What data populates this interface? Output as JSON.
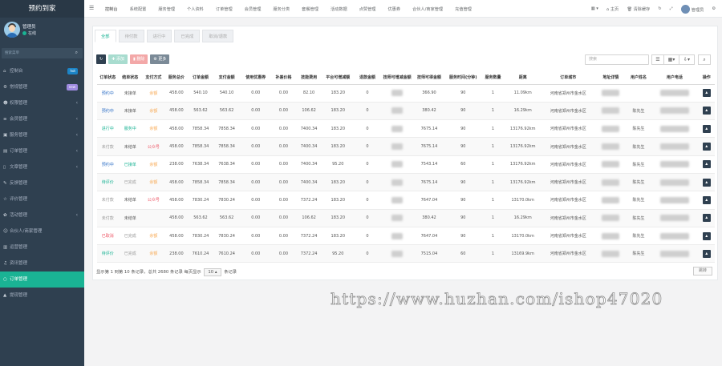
{
  "brand": "预约到家",
  "user": {
    "name": "管理员",
    "status": "在线"
  },
  "sidebar": {
    "search_placeholder": "搜索菜单",
    "items": [
      {
        "label": "控制台",
        "icon": "home-icon",
        "badge": "hot",
        "badge_color": "#1c84c6"
      },
      {
        "label": "常规管理",
        "icon": "cog-icon",
        "badge": "new",
        "badge_color": "#9e8be0"
      },
      {
        "label": "权限管理",
        "icon": "group-icon",
        "arrow": "‹"
      },
      {
        "label": "会员管理",
        "icon": "list-icon",
        "arrow": "‹"
      },
      {
        "label": "服务管理",
        "icon": "box-icon",
        "arrow": "‹"
      },
      {
        "label": "订单管理",
        "icon": "table-icon",
        "arrow": "‹"
      },
      {
        "label": "文章管理",
        "icon": "file-icon",
        "arrow": "‹"
      },
      {
        "label": "反馈管理",
        "icon": "comment-icon",
        "arrow": ""
      },
      {
        "label": "评价管理",
        "icon": "star-icon",
        "arrow": ""
      },
      {
        "label": "活动管理",
        "icon": "gift-icon",
        "arrow": "‹"
      },
      {
        "label": "合伙人/商家管理",
        "icon": "user-icon",
        "arrow": ""
      },
      {
        "label": "运营管理",
        "icon": "chart-icon",
        "arrow": ""
      },
      {
        "label": "资讯管理",
        "icon": "bell-icon",
        "arrow": ""
      },
      {
        "label": "订单管理",
        "icon": "circle-icon",
        "arrow": "",
        "active": true
      },
      {
        "label": "提现管理",
        "icon": "up-icon",
        "arrow": ""
      }
    ]
  },
  "topnav": [
    "控制台",
    "系统配置",
    "服务管理",
    "个人资料",
    "订单管理",
    "会员管理",
    "服务分类",
    "套餐管理",
    "活动数据",
    "点赞管理",
    "优惠券",
    "合伙人/商家管理",
    "充值管理"
  ],
  "topright": {
    "home": "主页",
    "clear": "清除缓存",
    "admin": "管理员"
  },
  "tabs": [
    "全部",
    "待付款",
    "进行中",
    "已完成",
    "取消/退款"
  ],
  "toolbar": {
    "add": "✚ 添加",
    "del": "▮ 删除",
    "more": "⚙ 更多"
  },
  "search_placeholder": "搜索",
  "table": {
    "headers": [
      "订单状态",
      "结单状态",
      "支付方式",
      "服务总价",
      "订单金额",
      "支付金额",
      "使用优惠券",
      "补差价格",
      "技能费用",
      "平台可增减额",
      "退款金额",
      "技师可增减金额",
      "技师可得金额",
      "服务时间(分钟)",
      "服务数量",
      "距离",
      "订单城市",
      "地址详情",
      "用户姓名",
      "用户电话",
      "操作"
    ],
    "rows": [
      [
        "预约中",
        "未接单",
        "余额",
        "458.00",
        "540.10",
        "540.10",
        "0.00",
        "0.00",
        "82.10",
        "183.20",
        "0",
        "",
        "366.90",
        "90",
        "1",
        "11.09km",
        "河南省郑州市金水区",
        "",
        "",
        "",
        ""
      ],
      [
        "预约中",
        "未接单",
        "余额",
        "458.00",
        "563.62",
        "563.62",
        "0.00",
        "0.00",
        "106.62",
        "183.20",
        "0",
        "",
        "380.42",
        "90",
        "1",
        "16.29km",
        "河南省郑州市金水区",
        "",
        "陈先生",
        "",
        ""
      ],
      [
        "进行中",
        "服务中",
        "余额",
        "458.00",
        "7858.34",
        "7858.34",
        "0.00",
        "0.00",
        "7400.34",
        "183.20",
        "0",
        "",
        "7675.14",
        "90",
        "1",
        "13176.92km",
        "河南省郑州市金水区",
        "",
        "陈先生",
        "",
        ""
      ],
      [
        "未付款",
        "未结单",
        "公众号",
        "458.00",
        "7858.34",
        "7858.34",
        "0.00",
        "0.00",
        "7400.34",
        "183.20",
        "0",
        "",
        "7675.14",
        "90",
        "1",
        "13176.92km",
        "河南省郑州市金水区",
        "",
        "陈先生",
        "",
        ""
      ],
      [
        "预约中",
        "已接单",
        "余额",
        "238.00",
        "7638.34",
        "7638.34",
        "0.00",
        "0.00",
        "7400.34",
        "95.20",
        "0",
        "",
        "7543.14",
        "60",
        "1",
        "13176.92km",
        "河南省郑州市金水区",
        "",
        "陈先生",
        "",
        ""
      ],
      [
        "待评价",
        "已完成",
        "余额",
        "458.00",
        "7858.34",
        "7858.34",
        "0.00",
        "0.00",
        "7400.34",
        "183.20",
        "0",
        "",
        "7675.14",
        "90",
        "1",
        "13176.92km",
        "河南省郑州市金水区",
        "",
        "陈先生",
        "",
        ""
      ],
      [
        "未付款",
        "未结单",
        "公众号",
        "458.00",
        "7830.24",
        "7830.24",
        "0.00",
        "0.00",
        "7372.24",
        "183.20",
        "0",
        "",
        "7647.04",
        "90",
        "1",
        "13170.0km",
        "河南省郑州市金水区",
        "",
        "陈先生",
        "",
        ""
      ],
      [
        "未付款",
        "未结单",
        "",
        "458.00",
        "563.62",
        "563.62",
        "0.00",
        "0.00",
        "106.62",
        "183.20",
        "0",
        "",
        "380.42",
        "90",
        "1",
        "16.29km",
        "河南省郑州市金水区",
        "",
        "陈先生",
        "",
        ""
      ],
      [
        "已取消",
        "已完成",
        "余额",
        "458.00",
        "7830.24",
        "7830.24",
        "0.00",
        "0.00",
        "7372.24",
        "183.20",
        "0",
        "",
        "7647.04",
        "90",
        "1",
        "13170.0km",
        "河南省郑州市金水区",
        "",
        "陈先生",
        "",
        ""
      ],
      [
        "待评价",
        "已完成",
        "余额",
        "238.00",
        "7610.24",
        "7610.24",
        "0.00",
        "0.00",
        "7372.24",
        "95.20",
        "0",
        "",
        "7515.04",
        "60",
        "1",
        "13169.9km",
        "河南省郑州市金水区",
        "",
        "陈先生",
        "",
        ""
      ]
    ]
  },
  "footer": {
    "left": "显示第 1 到第 10 条记录，总共 2680 条记录 每页显示",
    "page_size": "10 ▴",
    "right": "条记录",
    "pager": "跳转"
  },
  "watermark": "https://www.huzhan.com/ishop47020",
  "colors": {
    "sidebar": "#2f4050",
    "accent": "#1ab394",
    "danger": "#ed5565",
    "warning": "#f8ac59",
    "primary": "#1c84c6"
  }
}
